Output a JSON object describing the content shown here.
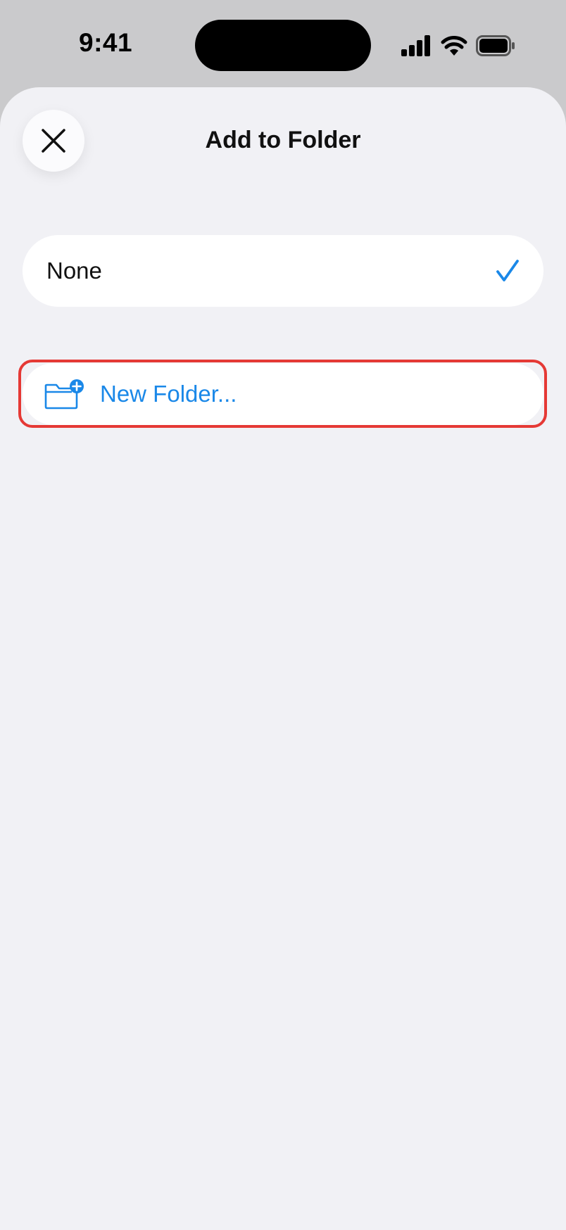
{
  "status_bar": {
    "time": "9:41"
  },
  "sheet": {
    "title": "Add to Folder",
    "close_icon": "close-icon"
  },
  "options": [
    {
      "label": "None",
      "selected": true,
      "icon": "checkmark-icon"
    }
  ],
  "new_folder": {
    "label": "New Folder...",
    "icon": "folder-plus-icon"
  },
  "colors": {
    "accent": "#1a88e8",
    "highlight_frame": "#e53935",
    "sheet_background": "#f1f1f5",
    "card_background": "#ffffff"
  }
}
